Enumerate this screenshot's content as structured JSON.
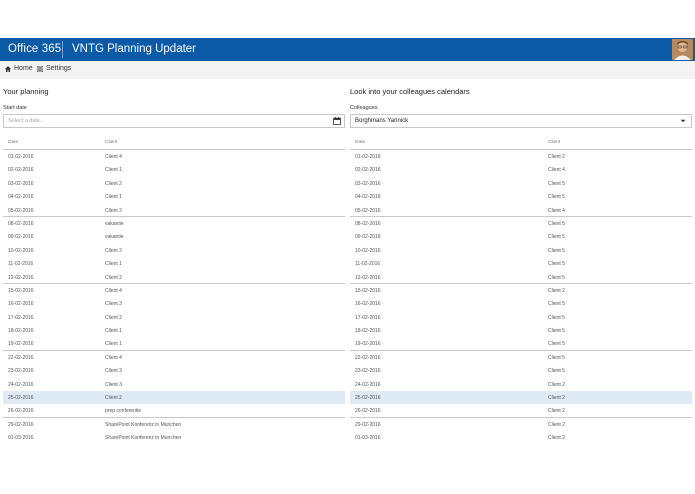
{
  "suitebar": {
    "brand": "Office 365",
    "app_name": "VNTG Planning Updater",
    "avatar_icon": "user-avatar",
    "color": "#0b5aa8"
  },
  "nav": {
    "home_label": "Home",
    "settings_label": "Settings"
  },
  "my_planning": {
    "title": "Your planning",
    "start_date_label": "Start date",
    "start_date_placeholder": "Select a date...",
    "columns": [
      "Date",
      "Client"
    ],
    "rows": [
      {
        "date": "01-02-2016",
        "client": "Client 4"
      },
      {
        "date": "02-02-2016",
        "client": "Client 1"
      },
      {
        "date": "03-02-2016",
        "client": "Client 2"
      },
      {
        "date": "04-02-2016",
        "client": "Client 1"
      },
      {
        "date": "05-02-2016",
        "client": "Client 2"
      },
      {
        "date": "08-02-2016",
        "client": "vakantie"
      },
      {
        "date": "09-02-2016",
        "client": "vakantie"
      },
      {
        "date": "10-02-2016",
        "client": "Client 2"
      },
      {
        "date": "11-02-2016",
        "client": "Client 1"
      },
      {
        "date": "12-02-2016",
        "client": "Client 2"
      },
      {
        "date": "15-02-2016",
        "client": "Client 4"
      },
      {
        "date": "16-02-2016",
        "client": "Client 3"
      },
      {
        "date": "17-02-2016",
        "client": "Client 2"
      },
      {
        "date": "18-02-2016",
        "client": "Client 1"
      },
      {
        "date": "19-02-2016",
        "client": "Client 1"
      },
      {
        "date": "22-02-2016",
        "client": "Client 4"
      },
      {
        "date": "23-02-2016",
        "client": "Client 3"
      },
      {
        "date": "24-02-2016",
        "client": "Client 3"
      },
      {
        "date": "25-02-2016",
        "client": "Client 2"
      },
      {
        "date": "26-02-2016",
        "client": "prep conferentie"
      },
      {
        "date": "29-02-2016",
        "client": "SharePoint Konferenz in Munchen"
      },
      {
        "date": "01-03-2016",
        "client": "SharePoint Konferenz in Munchen"
      }
    ]
  },
  "colleagues": {
    "title": "Look into your colleagues calendars",
    "select_label": "Colleagues",
    "selected_colleague": "Borghmans Yannick",
    "columns": [
      "Date",
      "Client"
    ],
    "rows": [
      {
        "date": "01-02-2016",
        "client": "Client 2"
      },
      {
        "date": "02-02-2016",
        "client": "Client 4"
      },
      {
        "date": "03-02-2016",
        "client": "Client 5"
      },
      {
        "date": "04-02-2016",
        "client": "Client 5"
      },
      {
        "date": "05-02-2016",
        "client": "Client 4"
      },
      {
        "date": "08-02-2016",
        "client": "Client 5"
      },
      {
        "date": "09-02-2016",
        "client": "Client 5"
      },
      {
        "date": "10-02-2016",
        "client": "Client 5"
      },
      {
        "date": "11-02-2016",
        "client": "Client 5"
      },
      {
        "date": "12-02-2016",
        "client": "Client 5"
      },
      {
        "date": "15-02-2016",
        "client": "Client 2"
      },
      {
        "date": "16-02-2016",
        "client": "Client 5"
      },
      {
        "date": "17-02-2016",
        "client": "Client 5"
      },
      {
        "date": "18-02-2016",
        "client": "Client 5"
      },
      {
        "date": "19-02-2016",
        "client": "Client 5"
      },
      {
        "date": "22-02-2016",
        "client": "Client 5"
      },
      {
        "date": "23-02-2016",
        "client": "Client 5"
      },
      {
        "date": "24-02-2016",
        "client": "Client 2"
      },
      {
        "date": "25-02-2016",
        "client": "Client 2"
      },
      {
        "date": "26-02-2016",
        "client": "Client 2"
      },
      {
        "date": "29-02-2016",
        "client": "Client 2"
      },
      {
        "date": "01-03-2016",
        "client": "Client 2"
      }
    ]
  },
  "selected_date": "25-02-2016",
  "highlight_color": "#dfeaf7"
}
